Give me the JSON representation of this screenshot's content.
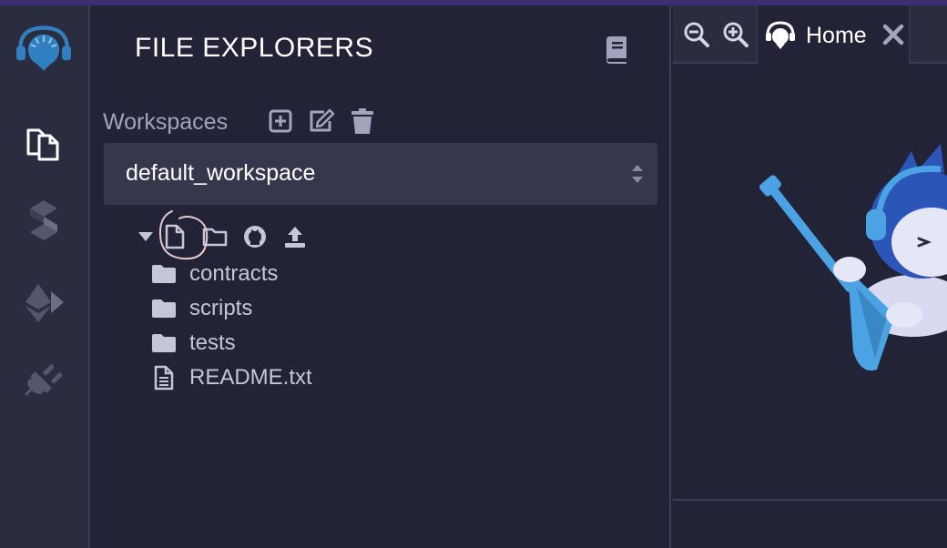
{
  "panel": {
    "title": "FILE EXPLORERS",
    "workspaces_label": "Workspaces",
    "workspace_selected": "default_workspace"
  },
  "rail": {
    "items": [
      {
        "icon": "remix-logo-icon"
      },
      {
        "icon": "file-explorer-icon"
      },
      {
        "icon": "solidity-compiler-icon"
      },
      {
        "icon": "ethereum-deploy-icon"
      },
      {
        "icon": "plugin-manager-icon"
      }
    ]
  },
  "tree": {
    "items": [
      {
        "type": "folder",
        "label": "contracts"
      },
      {
        "type": "folder",
        "label": "scripts"
      },
      {
        "type": "folder",
        "label": "tests"
      },
      {
        "type": "file",
        "label": "README.txt"
      }
    ]
  },
  "tabs": {
    "home_label": "Home"
  },
  "colors": {
    "background": "#222336",
    "rail": "#2a2c3f",
    "select_bg": "#35374c",
    "accent_blue": "#2f7fc1",
    "annotation": "#e9c9cc"
  }
}
